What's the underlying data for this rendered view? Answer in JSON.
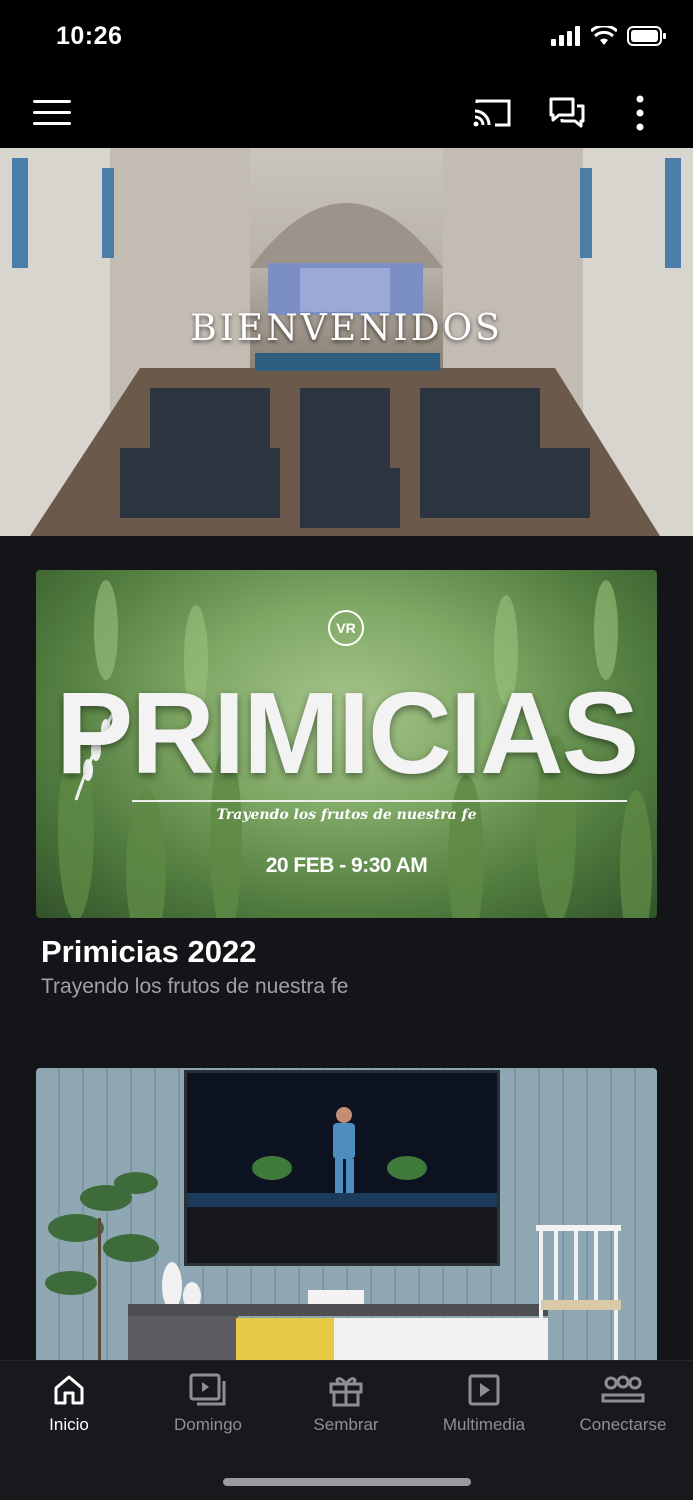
{
  "status_bar": {
    "time": "10:26"
  },
  "app_bar": {
    "menu_icon": "hamburger-menu-icon",
    "cast_icon": "cast-icon",
    "chat_icon": "chat-bubbles-icon",
    "more_icon": "more-vertical-icon"
  },
  "hero": {
    "overlay_text": "BIENVENIDOS"
  },
  "cards": [
    {
      "image": {
        "logo": "VR",
        "headline": "PRIMICIAS",
        "tagline": "Trayendo los frutos de nuestra fe",
        "date": "20 FEB - 9:30 AM"
      },
      "title": "Primicias 2022",
      "subtitle": "Trayendo los frutos de nuestra fe"
    }
  ],
  "tabs": [
    {
      "label": "Inicio",
      "icon": "home-icon",
      "active": true
    },
    {
      "label": "Domingo",
      "icon": "video-stack-icon",
      "active": false
    },
    {
      "label": "Sembrar",
      "icon": "gift-icon",
      "active": false
    },
    {
      "label": "Multimedia",
      "icon": "play-square-icon",
      "active": false
    },
    {
      "label": "Conectarse",
      "icon": "people-group-icon",
      "active": false
    }
  ],
  "colors": {
    "background": "#141518",
    "tab_active": "#ffffff",
    "tab_inactive": "#8e8f94"
  }
}
